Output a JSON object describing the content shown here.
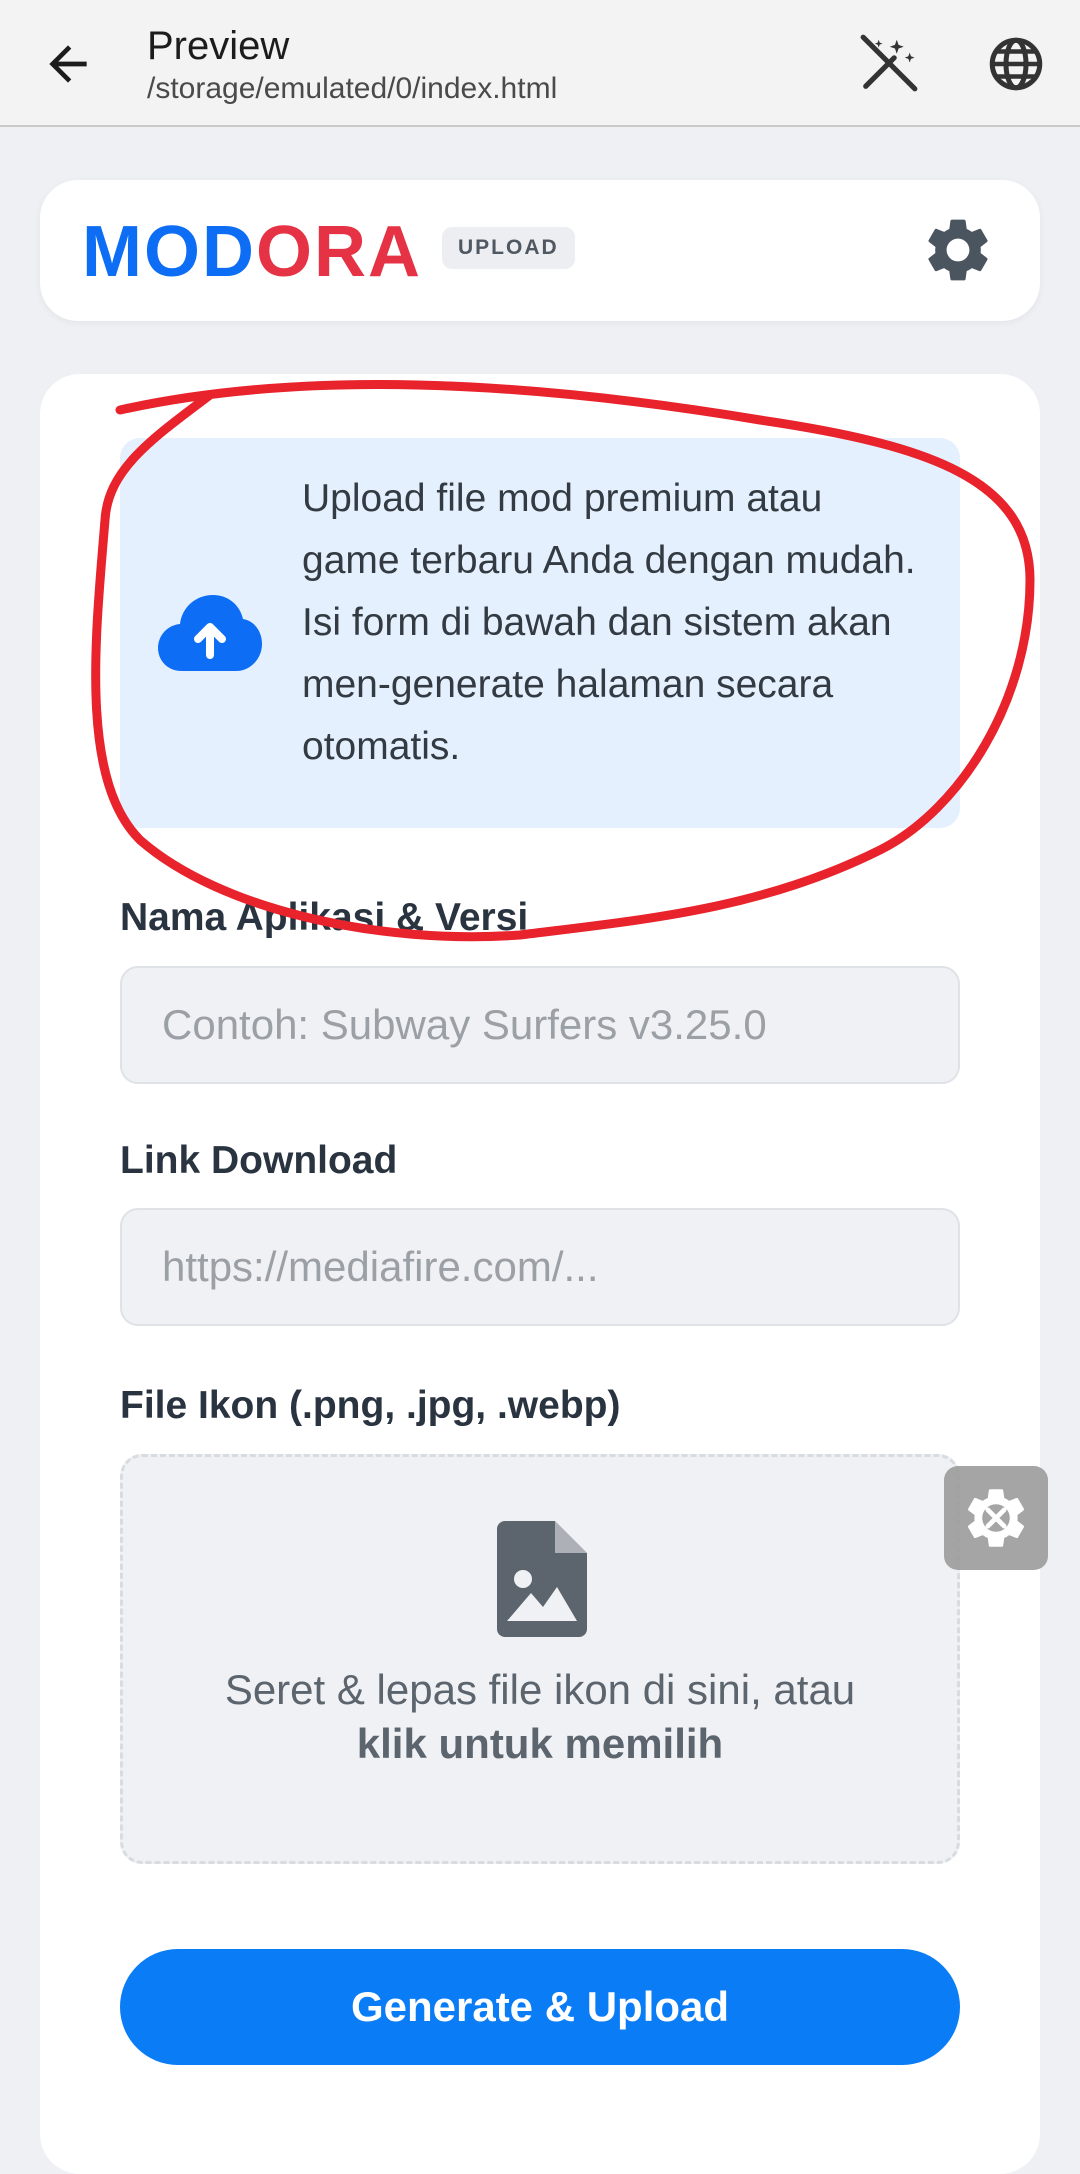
{
  "appbar": {
    "title": "Preview",
    "subtitle": "/storage/emulated/0/index.html",
    "icons": [
      "back-arrow-icon",
      "magic-wand-off-icon",
      "globe-icon"
    ]
  },
  "header": {
    "logo_part1": "MOD",
    "logo_part2": "ORA",
    "badge": "UPLOAD",
    "colors": {
      "logo_blue": "#0d6ef5",
      "logo_red": "#e53244"
    }
  },
  "info": {
    "text": "Upload file mod premium atau game terbaru Anda dengan mudah. Isi form di bawah dan sistem akan men-generate halaman secara otomatis."
  },
  "form": {
    "app_name_label": "Nama Aplikasi & Versi",
    "app_name_placeholder": "Contoh: Subway Surfers v3.25.0",
    "download_label": "Link Download",
    "download_placeholder": "https://mediafire.com/...",
    "icon_label": "File Ikon (.png, .jpg, .webp)",
    "dropzone_text": "Seret & lepas file ikon di sini, atau",
    "dropzone_bold": "klik untuk memilih",
    "submit_label": "Generate & Upload"
  },
  "colors": {
    "primary": "#0a7cf5",
    "info_bg": "#e4f0fe",
    "annotation": "#e8232c"
  }
}
